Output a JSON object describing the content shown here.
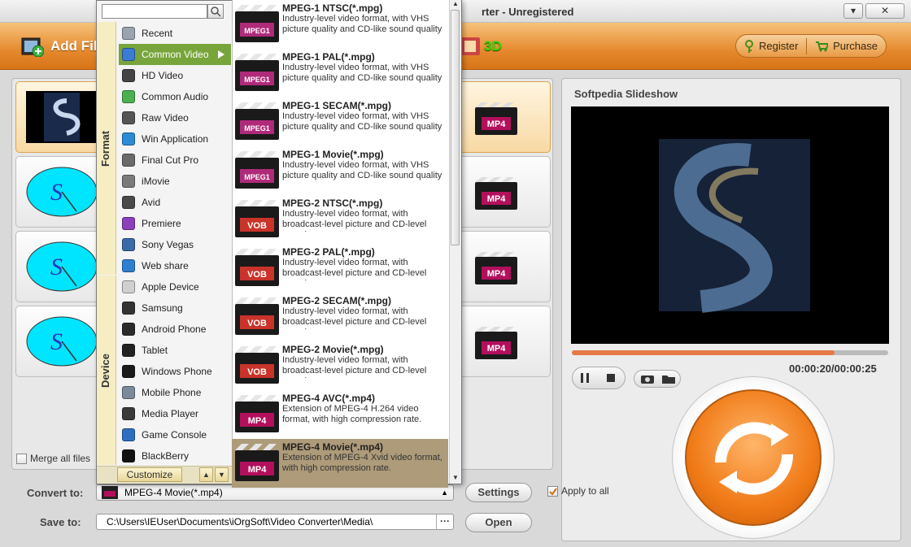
{
  "window": {
    "title": "rter - Unregistered",
    "minimize": "▾",
    "close": "✕"
  },
  "toolbar": {
    "add_files": "Add Fil",
    "three_d": "3D",
    "register": "Register",
    "purchase": "Purchase"
  },
  "files": [
    {
      "output_badge": "MP4",
      "selected": true
    },
    {
      "output_badge": "MP4",
      "selected": false
    },
    {
      "output_badge": "MP4",
      "selected": false
    },
    {
      "output_badge": "MP4",
      "selected": false
    }
  ],
  "merge_label": "Merge all files",
  "preview": {
    "title": "Softpedia Slideshow",
    "timecode": "00:00:20/00:00:25",
    "progress": 0.83
  },
  "bottom": {
    "convert_label": "Convert to:",
    "convert_value": "MPEG-4 Movie(*.mp4)",
    "settings": "Settings",
    "apply_all": "Apply to all",
    "save_label": "Save to:",
    "save_path": "C:\\Users\\IEUser\\Documents\\iOrgSoft\\Video Converter\\Media\\",
    "browse": "···",
    "open": "Open"
  },
  "menu": {
    "search_placeholder": "",
    "format_label": "Format",
    "device_label": "Device",
    "customize": "Customize",
    "format_categories": [
      {
        "label": "Recent",
        "icon": "recent-icon",
        "color": "#9aa4b0"
      },
      {
        "label": "Common Video",
        "icon": "common-video-icon",
        "color": "#3a7bd5",
        "selected": true
      },
      {
        "label": "HD Video",
        "icon": "hd-video-icon",
        "color": "#444444"
      },
      {
        "label": "Common Audio",
        "icon": "music-note-icon",
        "color": "#4caf50"
      },
      {
        "label": "Raw Video",
        "icon": "raw-video-icon",
        "color": "#555555"
      },
      {
        "label": "Win Application",
        "icon": "windows-icon",
        "color": "#2d8ad6"
      },
      {
        "label": "Final Cut Pro",
        "icon": "final-cut-icon",
        "color": "#6a6a6a"
      },
      {
        "label": "iMovie",
        "icon": "imovie-icon",
        "color": "#7a7a7a"
      },
      {
        "label": "Avid",
        "icon": "avid-icon",
        "color": "#4a4a4a"
      },
      {
        "label": "Premiere",
        "icon": "premiere-icon",
        "color": "#8b3fb8"
      },
      {
        "label": "Sony Vegas",
        "icon": "sony-vegas-icon",
        "color": "#3a6aa8"
      },
      {
        "label": "Web share",
        "icon": "globe-icon",
        "color": "#2f7fd0"
      }
    ],
    "device_categories": [
      {
        "label": "Apple Device",
        "icon": "apple-device-icon",
        "color": "#d0d0d0"
      },
      {
        "label": "Samsung",
        "icon": "samsung-icon",
        "color": "#333333"
      },
      {
        "label": "Android Phone",
        "icon": "android-phone-icon",
        "color": "#2a2a2a"
      },
      {
        "label": "Tablet",
        "icon": "tablet-icon",
        "color": "#222222"
      },
      {
        "label": "Windows Phone",
        "icon": "windows-phone-icon",
        "color": "#1a1a1a"
      },
      {
        "label": "Mobile Phone",
        "icon": "mobile-phone-icon",
        "color": "#7a8a9a"
      },
      {
        "label": "Media Player",
        "icon": "media-player-icon",
        "color": "#3a3a3a"
      },
      {
        "label": "Game Console",
        "icon": "game-console-icon",
        "color": "#2f6fbf"
      },
      {
        "label": "BlackBerry",
        "icon": "blackberry-icon",
        "color": "#111111"
      }
    ],
    "formats": [
      {
        "name": "MPEG-1 NTSC(*.mpg)",
        "badge": "MPEG1",
        "desc": "Industry-level video format, with VHS picture quality and CD-like sound quality"
      },
      {
        "name": "MPEG-1 PAL(*.mpg)",
        "badge": "MPEG1",
        "desc": "Industry-level video format, with VHS picture quality and CD-like sound quality"
      },
      {
        "name": "MPEG-1 SECAM(*.mpg)",
        "badge": "MPEG1",
        "desc": "Industry-level video format, with VHS picture quality and CD-like sound quality"
      },
      {
        "name": "MPEG-1 Movie(*.mpg)",
        "badge": "MPEG1",
        "desc": "Industry-level video format, with VHS picture quality and CD-like sound quality"
      },
      {
        "name": "MPEG-2 NTSC(*.mpg)",
        "badge": "VOB",
        "desc": "Industry-level video format, with broadcast-level picture and CD-level sound"
      },
      {
        "name": "MPEG-2 PAL(*.mpg)",
        "badge": "VOB",
        "desc": "Industry-level video format, with broadcast-level picture and CD-level sound"
      },
      {
        "name": "MPEG-2 SECAM(*.mpg)",
        "badge": "VOB",
        "desc": "Industry-level video format, with broadcast-level picture and CD-level sound"
      },
      {
        "name": "MPEG-2 Movie(*.mpg)",
        "badge": "VOB",
        "desc": "Industry-level video format, with broadcast-level picture and CD-level sound"
      },
      {
        "name": "MPEG-4 AVC(*.mp4)",
        "badge": "MP4",
        "desc": "Extension of MPEG-4 H.264 video format, with high compression rate."
      },
      {
        "name": "MPEG-4 Movie(*.mp4)",
        "badge": "MP4",
        "desc": "Extension of MPEG-4 Xvid video format, with high compression rate.",
        "selected": true
      }
    ]
  },
  "colors": {
    "toolbar_orange": "#e5892d",
    "selected_green": "#77a53b",
    "convert_orange": "#f07a16"
  }
}
